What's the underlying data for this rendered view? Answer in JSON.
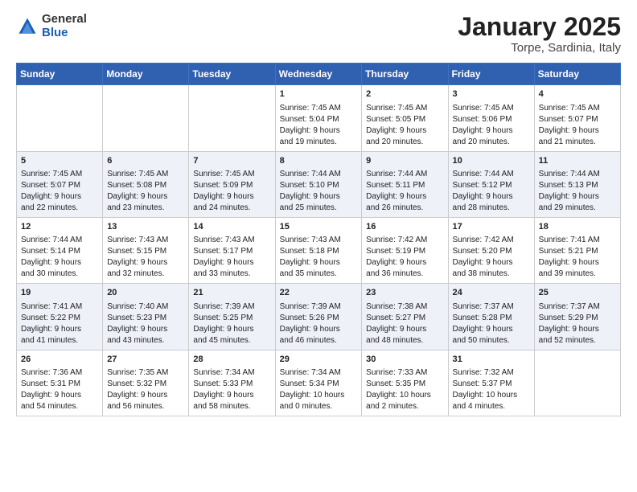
{
  "header": {
    "logo_general": "General",
    "logo_blue": "Blue",
    "title": "January 2025",
    "location": "Torpe, Sardinia, Italy"
  },
  "days_of_week": [
    "Sunday",
    "Monday",
    "Tuesday",
    "Wednesday",
    "Thursday",
    "Friday",
    "Saturday"
  ],
  "weeks": [
    [
      {
        "day": "",
        "info": ""
      },
      {
        "day": "",
        "info": ""
      },
      {
        "day": "",
        "info": ""
      },
      {
        "day": "1",
        "info": "Sunrise: 7:45 AM\nSunset: 5:04 PM\nDaylight: 9 hours\nand 19 minutes."
      },
      {
        "day": "2",
        "info": "Sunrise: 7:45 AM\nSunset: 5:05 PM\nDaylight: 9 hours\nand 20 minutes."
      },
      {
        "day": "3",
        "info": "Sunrise: 7:45 AM\nSunset: 5:06 PM\nDaylight: 9 hours\nand 20 minutes."
      },
      {
        "day": "4",
        "info": "Sunrise: 7:45 AM\nSunset: 5:07 PM\nDaylight: 9 hours\nand 21 minutes."
      }
    ],
    [
      {
        "day": "5",
        "info": "Sunrise: 7:45 AM\nSunset: 5:07 PM\nDaylight: 9 hours\nand 22 minutes."
      },
      {
        "day": "6",
        "info": "Sunrise: 7:45 AM\nSunset: 5:08 PM\nDaylight: 9 hours\nand 23 minutes."
      },
      {
        "day": "7",
        "info": "Sunrise: 7:45 AM\nSunset: 5:09 PM\nDaylight: 9 hours\nand 24 minutes."
      },
      {
        "day": "8",
        "info": "Sunrise: 7:44 AM\nSunset: 5:10 PM\nDaylight: 9 hours\nand 25 minutes."
      },
      {
        "day": "9",
        "info": "Sunrise: 7:44 AM\nSunset: 5:11 PM\nDaylight: 9 hours\nand 26 minutes."
      },
      {
        "day": "10",
        "info": "Sunrise: 7:44 AM\nSunset: 5:12 PM\nDaylight: 9 hours\nand 28 minutes."
      },
      {
        "day": "11",
        "info": "Sunrise: 7:44 AM\nSunset: 5:13 PM\nDaylight: 9 hours\nand 29 minutes."
      }
    ],
    [
      {
        "day": "12",
        "info": "Sunrise: 7:44 AM\nSunset: 5:14 PM\nDaylight: 9 hours\nand 30 minutes."
      },
      {
        "day": "13",
        "info": "Sunrise: 7:43 AM\nSunset: 5:15 PM\nDaylight: 9 hours\nand 32 minutes."
      },
      {
        "day": "14",
        "info": "Sunrise: 7:43 AM\nSunset: 5:17 PM\nDaylight: 9 hours\nand 33 minutes."
      },
      {
        "day": "15",
        "info": "Sunrise: 7:43 AM\nSunset: 5:18 PM\nDaylight: 9 hours\nand 35 minutes."
      },
      {
        "day": "16",
        "info": "Sunrise: 7:42 AM\nSunset: 5:19 PM\nDaylight: 9 hours\nand 36 minutes."
      },
      {
        "day": "17",
        "info": "Sunrise: 7:42 AM\nSunset: 5:20 PM\nDaylight: 9 hours\nand 38 minutes."
      },
      {
        "day": "18",
        "info": "Sunrise: 7:41 AM\nSunset: 5:21 PM\nDaylight: 9 hours\nand 39 minutes."
      }
    ],
    [
      {
        "day": "19",
        "info": "Sunrise: 7:41 AM\nSunset: 5:22 PM\nDaylight: 9 hours\nand 41 minutes."
      },
      {
        "day": "20",
        "info": "Sunrise: 7:40 AM\nSunset: 5:23 PM\nDaylight: 9 hours\nand 43 minutes."
      },
      {
        "day": "21",
        "info": "Sunrise: 7:39 AM\nSunset: 5:25 PM\nDaylight: 9 hours\nand 45 minutes."
      },
      {
        "day": "22",
        "info": "Sunrise: 7:39 AM\nSunset: 5:26 PM\nDaylight: 9 hours\nand 46 minutes."
      },
      {
        "day": "23",
        "info": "Sunrise: 7:38 AM\nSunset: 5:27 PM\nDaylight: 9 hours\nand 48 minutes."
      },
      {
        "day": "24",
        "info": "Sunrise: 7:37 AM\nSunset: 5:28 PM\nDaylight: 9 hours\nand 50 minutes."
      },
      {
        "day": "25",
        "info": "Sunrise: 7:37 AM\nSunset: 5:29 PM\nDaylight: 9 hours\nand 52 minutes."
      }
    ],
    [
      {
        "day": "26",
        "info": "Sunrise: 7:36 AM\nSunset: 5:31 PM\nDaylight: 9 hours\nand 54 minutes."
      },
      {
        "day": "27",
        "info": "Sunrise: 7:35 AM\nSunset: 5:32 PM\nDaylight: 9 hours\nand 56 minutes."
      },
      {
        "day": "28",
        "info": "Sunrise: 7:34 AM\nSunset: 5:33 PM\nDaylight: 9 hours\nand 58 minutes."
      },
      {
        "day": "29",
        "info": "Sunrise: 7:34 AM\nSunset: 5:34 PM\nDaylight: 10 hours\nand 0 minutes."
      },
      {
        "day": "30",
        "info": "Sunrise: 7:33 AM\nSunset: 5:35 PM\nDaylight: 10 hours\nand 2 minutes."
      },
      {
        "day": "31",
        "info": "Sunrise: 7:32 AM\nSunset: 5:37 PM\nDaylight: 10 hours\nand 4 minutes."
      },
      {
        "day": "",
        "info": ""
      }
    ]
  ]
}
